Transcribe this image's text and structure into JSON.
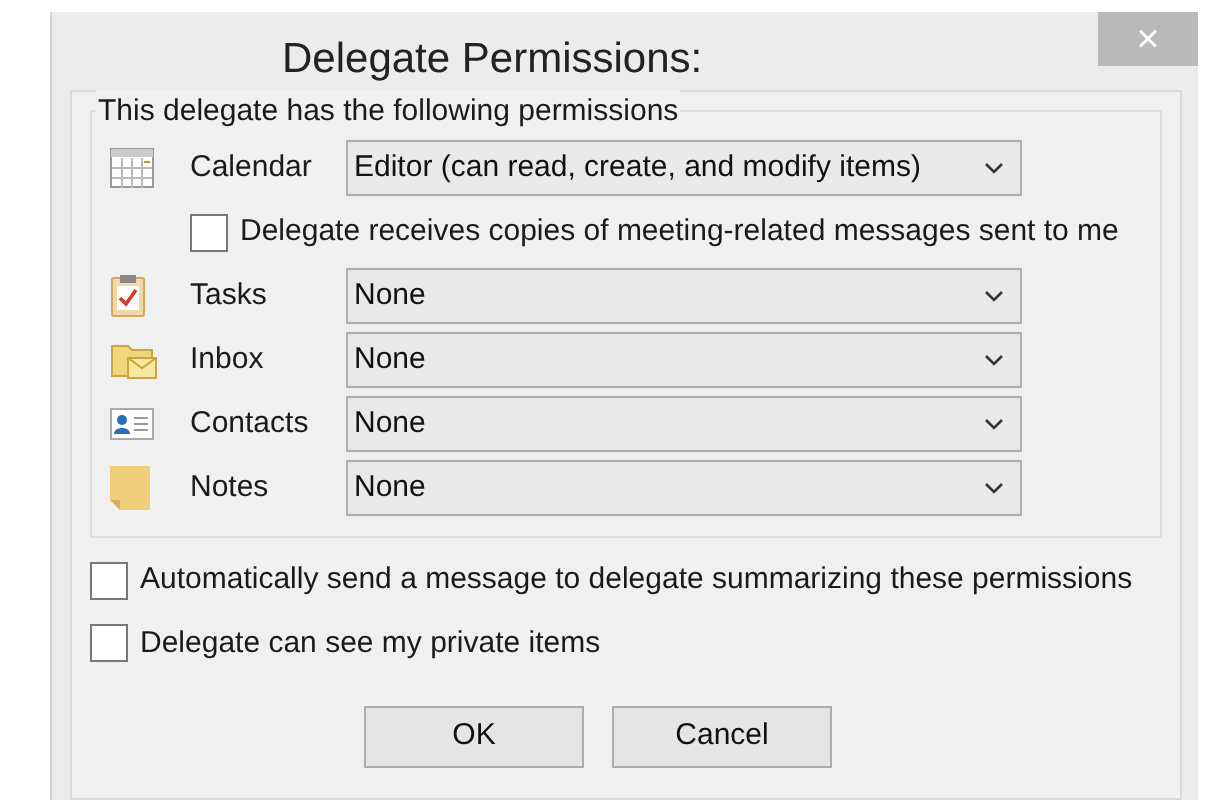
{
  "window": {
    "title": "Delegate Permissions:",
    "close": "×"
  },
  "group": {
    "label": "This delegate has the following permissions"
  },
  "folders": [
    {
      "kind": "calendar",
      "label": "Calendar",
      "value": "Editor (can read, create, and modify items)"
    },
    {
      "kind": "tasks",
      "label": "Tasks",
      "value": "None"
    },
    {
      "kind": "inbox",
      "label": "Inbox",
      "value": "None"
    },
    {
      "kind": "contacts",
      "label": "Contacts",
      "value": "None"
    },
    {
      "kind": "notes",
      "label": "Notes",
      "value": "None"
    }
  ],
  "meeting_copies": {
    "label": "Delegate receives copies of meeting-related messages sent to me",
    "checked": false
  },
  "options": [
    {
      "label": "Automatically send a message to delegate summarizing these permissions",
      "checked": false
    },
    {
      "label": "Delegate can see my private items",
      "checked": false
    }
  ],
  "buttons": [
    "OK",
    "Cancel"
  ]
}
